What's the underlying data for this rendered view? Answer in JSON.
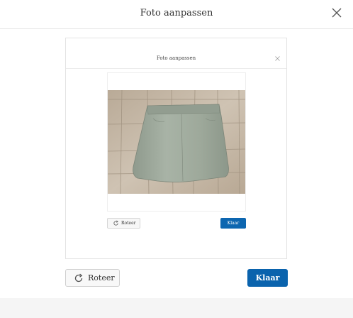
{
  "dialog": {
    "title": "Foto aanpassen",
    "rotate_label": "Roteer",
    "done_label": "Klaar"
  },
  "preview": {
    "title": "Foto aanpassen",
    "rotate_label": "Roteer",
    "done_label": "Klaar"
  },
  "icons": {
    "close": "close-icon",
    "rotate": "rotate-icon"
  },
  "colors": {
    "primary": "#0a63ad",
    "border": "#e3e3e3",
    "button_bg": "#f8f8f8"
  }
}
